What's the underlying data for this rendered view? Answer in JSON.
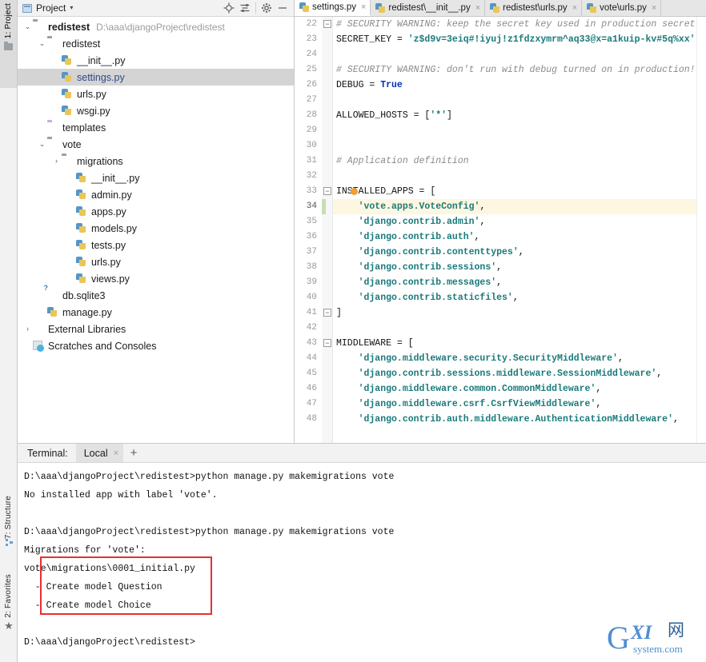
{
  "left_strip": {
    "project_tab": "1: Project",
    "structure_tab": "7: Structure",
    "favorites_tab": "2: Favorites"
  },
  "project_panel": {
    "title": "Project",
    "caret": "▾",
    "icons": {
      "locate": "locate-icon",
      "collapse": "collapse-all-icon",
      "settings": "gear-icon",
      "hide": "hide-icon"
    },
    "tree": [
      {
        "arrow": "⌄",
        "indent": 0,
        "icon": "folder",
        "label": "redistest",
        "bold": true,
        "path": "D:\\aaa\\djangoProject\\redistest",
        "selected": false
      },
      {
        "arrow": "⌄",
        "indent": 1,
        "icon": "folder",
        "label": "redistest",
        "bold": false,
        "path": "",
        "selected": false
      },
      {
        "arrow": "",
        "indent": 2,
        "icon": "py",
        "label": "__init__.py",
        "bold": false,
        "path": "",
        "selected": false
      },
      {
        "arrow": "",
        "indent": 2,
        "icon": "py",
        "label": "settings.py",
        "bold": false,
        "path": "",
        "selected": true
      },
      {
        "arrow": "",
        "indent": 2,
        "icon": "py",
        "label": "urls.py",
        "bold": false,
        "path": "",
        "selected": false
      },
      {
        "arrow": "",
        "indent": 2,
        "icon": "py",
        "label": "wsgi.py",
        "bold": false,
        "path": "",
        "selected": false
      },
      {
        "arrow": "",
        "indent": 1,
        "icon": "folder-purple",
        "label": "templates",
        "bold": false,
        "path": "",
        "selected": false
      },
      {
        "arrow": "⌄",
        "indent": 1,
        "icon": "folder",
        "label": "vote",
        "bold": false,
        "path": "",
        "selected": false
      },
      {
        "arrow": "›",
        "indent": 2,
        "icon": "folder",
        "label": "migrations",
        "bold": false,
        "path": "",
        "selected": false
      },
      {
        "arrow": "",
        "indent": 3,
        "icon": "py",
        "label": "__init__.py",
        "bold": false,
        "path": "",
        "selected": false
      },
      {
        "arrow": "",
        "indent": 3,
        "icon": "py",
        "label": "admin.py",
        "bold": false,
        "path": "",
        "selected": false
      },
      {
        "arrow": "",
        "indent": 3,
        "icon": "py",
        "label": "apps.py",
        "bold": false,
        "path": "",
        "selected": false
      },
      {
        "arrow": "",
        "indent": 3,
        "icon": "py",
        "label": "models.py",
        "bold": false,
        "path": "",
        "selected": false
      },
      {
        "arrow": "",
        "indent": 3,
        "icon": "py",
        "label": "tests.py",
        "bold": false,
        "path": "",
        "selected": false
      },
      {
        "arrow": "",
        "indent": 3,
        "icon": "py",
        "label": "urls.py",
        "bold": false,
        "path": "",
        "selected": false
      },
      {
        "arrow": "",
        "indent": 3,
        "icon": "py",
        "label": "views.py",
        "bold": false,
        "path": "",
        "selected": false
      },
      {
        "arrow": "",
        "indent": 1,
        "icon": "db",
        "label": "db.sqlite3",
        "bold": false,
        "path": "",
        "selected": false
      },
      {
        "arrow": "",
        "indent": 1,
        "icon": "py",
        "label": "manage.py",
        "bold": false,
        "path": "",
        "selected": false
      },
      {
        "arrow": "›",
        "indent": 0,
        "icon": "lib",
        "label": "External Libraries",
        "bold": false,
        "path": "",
        "selected": false
      },
      {
        "arrow": "",
        "indent": 0,
        "icon": "scratch",
        "label": "Scratches and Consoles",
        "bold": false,
        "path": "",
        "selected": false
      }
    ]
  },
  "editor": {
    "tabs": [
      {
        "label": "settings.py",
        "active": true,
        "close": "×"
      },
      {
        "label": "redistest\\__init__.py",
        "active": false,
        "close": "×"
      },
      {
        "label": "redistest\\urls.py",
        "active": false,
        "close": "×"
      },
      {
        "label": "vote\\urls.py",
        "active": false,
        "close": "×"
      }
    ],
    "first_line_number": 22,
    "current_line": 34,
    "lines": [
      {
        "n": 22,
        "fold": "minus",
        "segs": [
          {
            "t": "com",
            "s": "# SECURITY WARNING: keep the secret key used in production secret!"
          }
        ]
      },
      {
        "n": 23,
        "fold": "",
        "segs": [
          {
            "t": "id",
            "s": "SECRET_KEY = "
          },
          {
            "t": "str",
            "s": "'z$d9v=3eiq#!iyuj!z1fdzxymrm^aq33@x=a1kuip-kv#5q%xx'"
          }
        ]
      },
      {
        "n": 24,
        "fold": "",
        "segs": []
      },
      {
        "n": 25,
        "fold": "",
        "segs": [
          {
            "t": "com",
            "s": "# SECURITY WARNING: don't run with debug turned on in production!"
          }
        ]
      },
      {
        "n": 26,
        "fold": "",
        "segs": [
          {
            "t": "id",
            "s": "DEBUG = "
          },
          {
            "t": "kw",
            "s": "True"
          }
        ]
      },
      {
        "n": 27,
        "fold": "",
        "segs": []
      },
      {
        "n": 28,
        "fold": "",
        "segs": [
          {
            "t": "id",
            "s": "ALLOWED_HOSTS = ["
          },
          {
            "t": "str",
            "s": "'*'"
          },
          {
            "t": "id",
            "s": "]"
          }
        ]
      },
      {
        "n": 29,
        "fold": "",
        "segs": []
      },
      {
        "n": 30,
        "fold": "",
        "segs": []
      },
      {
        "n": 31,
        "fold": "",
        "segs": [
          {
            "t": "com",
            "s": "# Application definition"
          }
        ]
      },
      {
        "n": 32,
        "fold": "",
        "segs": []
      },
      {
        "n": 33,
        "fold": "minus",
        "segs": [
          {
            "t": "id",
            "s": "INSTALLED_APPS = ["
          }
        ]
      },
      {
        "n": 34,
        "fold": "",
        "segs": [
          {
            "t": "str",
            "s": "    'vote.apps.VoteConfig'"
          },
          {
            "t": "id",
            "s": ","
          }
        ]
      },
      {
        "n": 35,
        "fold": "",
        "segs": [
          {
            "t": "str",
            "s": "    'django.contrib.admin'"
          },
          {
            "t": "id",
            "s": ","
          }
        ]
      },
      {
        "n": 36,
        "fold": "",
        "segs": [
          {
            "t": "str",
            "s": "    'django.contrib.auth'"
          },
          {
            "t": "id",
            "s": ","
          }
        ]
      },
      {
        "n": 37,
        "fold": "",
        "segs": [
          {
            "t": "str",
            "s": "    'django.contrib.contenttypes'"
          },
          {
            "t": "id",
            "s": ","
          }
        ]
      },
      {
        "n": 38,
        "fold": "",
        "segs": [
          {
            "t": "str",
            "s": "    'django.contrib.sessions'"
          },
          {
            "t": "id",
            "s": ","
          }
        ]
      },
      {
        "n": 39,
        "fold": "",
        "segs": [
          {
            "t": "str",
            "s": "    'django.contrib.messages'"
          },
          {
            "t": "id",
            "s": ","
          }
        ]
      },
      {
        "n": 40,
        "fold": "",
        "segs": [
          {
            "t": "str",
            "s": "    'django.contrib.staticfiles'"
          },
          {
            "t": "id",
            "s": ","
          }
        ]
      },
      {
        "n": 41,
        "fold": "minus",
        "segs": [
          {
            "t": "id",
            "s": "]"
          }
        ]
      },
      {
        "n": 42,
        "fold": "",
        "segs": []
      },
      {
        "n": 43,
        "fold": "minus",
        "segs": [
          {
            "t": "id",
            "s": "MIDDLEWARE = ["
          }
        ]
      },
      {
        "n": 44,
        "fold": "",
        "segs": [
          {
            "t": "str",
            "s": "    'django.middleware.security.SecurityMiddleware'"
          },
          {
            "t": "id",
            "s": ","
          }
        ]
      },
      {
        "n": 45,
        "fold": "",
        "segs": [
          {
            "t": "str",
            "s": "    'django.contrib.sessions.middleware.SessionMiddleware'"
          },
          {
            "t": "id",
            "s": ","
          }
        ]
      },
      {
        "n": 46,
        "fold": "",
        "segs": [
          {
            "t": "str",
            "s": "    'django.middleware.common.CommonMiddleware'"
          },
          {
            "t": "id",
            "s": ","
          }
        ]
      },
      {
        "n": 47,
        "fold": "",
        "segs": [
          {
            "t": "str",
            "s": "    'django.middleware.csrf.CsrfViewMiddleware'"
          },
          {
            "t": "id",
            "s": ","
          }
        ]
      },
      {
        "n": 48,
        "fold": "",
        "segs": [
          {
            "t": "str",
            "s": "    'django.contrib.auth.middleware.AuthenticationMiddleware'"
          },
          {
            "t": "id",
            "s": ","
          }
        ]
      }
    ]
  },
  "terminal": {
    "label": "Terminal:",
    "tab": "Local",
    "tab_close": "×",
    "add": "+",
    "lines": [
      "D:\\aaa\\djangoProject\\redistest>python manage.py makemigrations vote",
      "No installed app with label 'vote'.",
      "",
      "D:\\aaa\\djangoProject\\redistest>python manage.py makemigrations vote",
      "Migrations for 'vote':",
      "vote\\migrations\\0001_initial.py",
      "  - Create model Question",
      "  - Create model Choice",
      "",
      "D:\\aaa\\djangoProject\\redistest>"
    ],
    "highlight_color": "#e8302f"
  },
  "watermark": {
    "g": "G",
    "xi": "XI",
    "cjk": "网",
    "sys": "system.com"
  }
}
